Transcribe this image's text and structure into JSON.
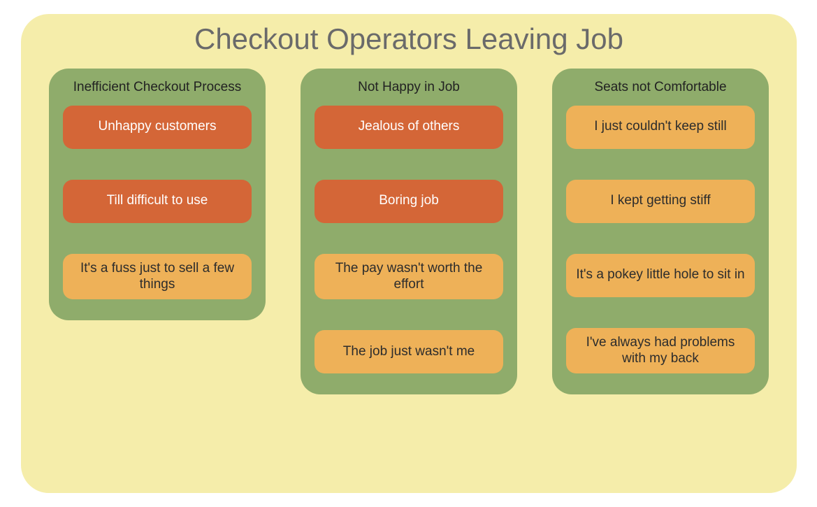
{
  "title": "Checkout Operators Leaving Job",
  "columns": [
    {
      "header": "Inefficient Checkout Process",
      "cards": [
        {
          "text": "Unhappy customers",
          "style": "orange"
        },
        {
          "text": "Till difficult to use",
          "style": "orange"
        },
        {
          "text": "It's a fuss just to sell a few things",
          "style": "yellow"
        }
      ]
    },
    {
      "header": "Not Happy in Job",
      "cards": [
        {
          "text": "Jealous of others",
          "style": "orange"
        },
        {
          "text": "Boring job",
          "style": "orange"
        },
        {
          "text": "The pay wasn't worth the effort",
          "style": "yellow"
        },
        {
          "text": "The job just wasn't me",
          "style": "yellow"
        }
      ]
    },
    {
      "header": "Seats not Comfortable",
      "cards": [
        {
          "text": "I just couldn't keep still",
          "style": "yellow"
        },
        {
          "text": "I kept getting stiff",
          "style": "yellow"
        },
        {
          "text": "It's a pokey little hole to sit in",
          "style": "yellow"
        },
        {
          "text": "I've always had problems with my back",
          "style": "yellow"
        }
      ]
    }
  ]
}
